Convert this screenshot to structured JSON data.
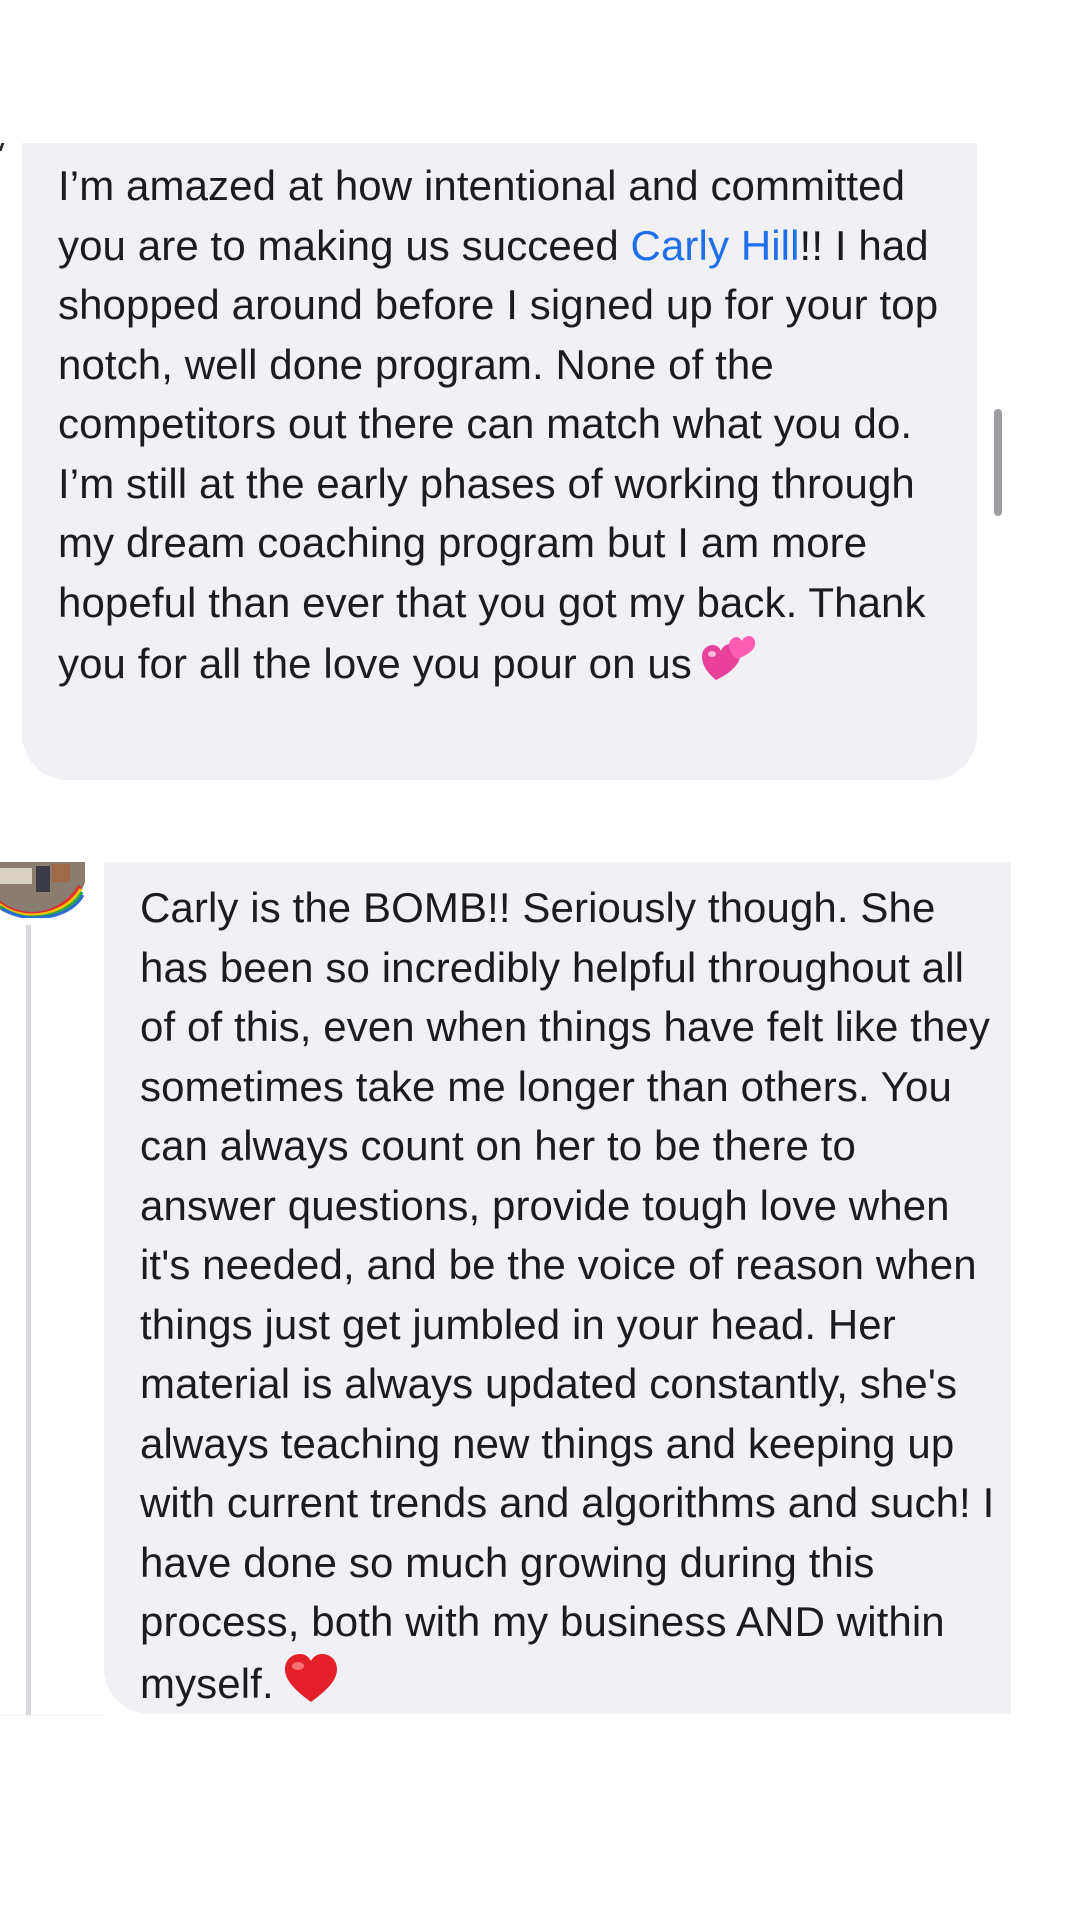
{
  "comments": [
    {
      "text_before_mention": "I’m amazed at how intentional and committed you are to making us succeed ",
      "mention": "Carly Hill",
      "text_after_mention": "!! I had shopped around before I signed up for your top notch, well done program. None of the competitors out there can match what you do. I’m still at the early phases of working through my dream coaching program but I am more hopeful than ever that you got my back. Thank you for all the love you pour on us",
      "emoji": "two-hearts-emoji"
    },
    {
      "text": "Carly is the BOMB!! Seriously though. She has been so incredibly helpful throughout all of of this, even when things have felt like they sometimes take me longer than others. You can always count on her to be there to answer questions, provide tough love when it's needed, and be the voice of reason when things just get jumbled in your head. Her material is always updated constantly, she's always teaching new things and keeping up with current trends and algorithms and such! I have done so much growing during this process, both with my business AND within myself.",
      "emoji": "red-heart-emoji"
    }
  ],
  "colors": {
    "bubble_background": "#f0f0f5",
    "mention": "#1f6feb",
    "text": "#1c1c1e",
    "thread_line": "#d8d8de"
  }
}
